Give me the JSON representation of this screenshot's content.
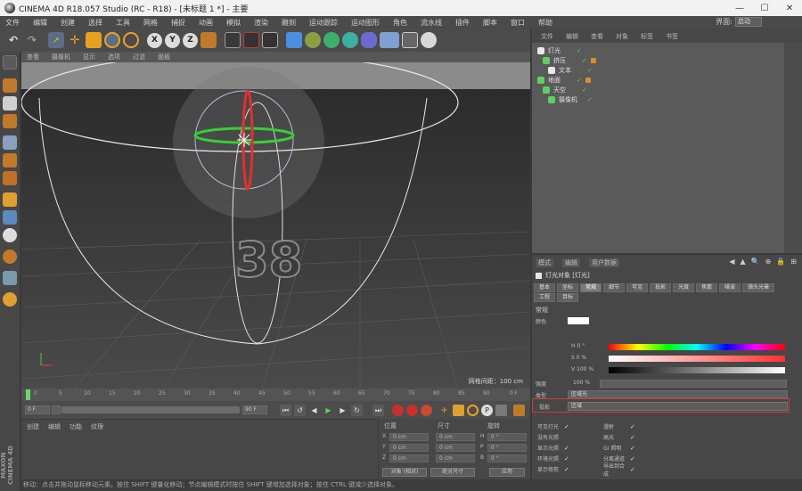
{
  "window": {
    "title": "CINEMA 4D R18.057 Studio (RC - R18) - [未标题 1 *] - 主要",
    "minimize": "—",
    "maximize": "☐",
    "close": "✕"
  },
  "menubar": {
    "items": [
      "文件",
      "编辑",
      "创建",
      "选择",
      "工具",
      "网格",
      "捕捉",
      "动画",
      "模拟",
      "渲染",
      "雕刻",
      "运动跟踪",
      "运动图形",
      "角色",
      "流水线",
      "插件",
      "脚本",
      "窗口",
      "帮助"
    ],
    "layout_label": "界面:",
    "layout_value": "启动"
  },
  "toolbar": {
    "x_label": "X",
    "y_label": "Y",
    "z_label": "Z"
  },
  "viewport": {
    "menu": [
      "查看",
      "摄像机",
      "显示",
      "选项",
      "过滤",
      "面板"
    ],
    "label": "网格间距：100 cm",
    "text_3d": "38"
  },
  "timeline": {
    "ticks": [
      "0",
      "5",
      "10",
      "15",
      "20",
      "25",
      "30",
      "35",
      "40",
      "45",
      "50",
      "55",
      "60",
      "65",
      "70",
      "75",
      "80",
      "85",
      "90",
      "0 F"
    ],
    "start_frame": "0 F",
    "current_frame": "0 F",
    "end_frame": "90 F"
  },
  "material_manager": {
    "menu": [
      "创建",
      "编辑",
      "功能",
      "纹理"
    ]
  },
  "coordinates": {
    "headers": [
      "位置",
      "尺寸",
      "旋转"
    ],
    "rows": [
      {
        "axis": "X",
        "pos": "0 cm",
        "size": "0 cm",
        "rot_axis": "H",
        "rot": "0 °"
      },
      {
        "axis": "Y",
        "pos": "0 cm",
        "size": "0 cm",
        "rot_axis": "P",
        "rot": "0 °"
      },
      {
        "axis": "Z",
        "pos": "0 cm",
        "size": "0 cm",
        "rot_axis": "B",
        "rot": "0 °"
      }
    ],
    "mode": "对象 (相对)",
    "size_mode": "绝对尺寸",
    "apply": "应用"
  },
  "object_manager": {
    "menu": [
      "文件",
      "编辑",
      "查看",
      "对象",
      "标签",
      "书签"
    ],
    "objects": [
      {
        "name": "灯光",
        "color": "#e8e8e8"
      },
      {
        "name": "挤压",
        "color": "#5fd05f"
      },
      {
        "name": "文本",
        "color": "#e8e8e8"
      },
      {
        "name": "地面",
        "color": "#5fd05f"
      },
      {
        "name": "天空",
        "color": "#5fd05f"
      },
      {
        "name": "摄像机",
        "color": "#5fd05f"
      }
    ],
    "check": "✓"
  },
  "attribute_manager": {
    "menu": [
      "模式",
      "编辑",
      "用户数据"
    ],
    "nav_icons": [
      "◀",
      "▲",
      "🔍",
      "⊕",
      "🔒",
      "⊞"
    ],
    "object_name": "灯光对象 [灯光]",
    "tabs_row1": [
      "基本",
      "坐标",
      "常规",
      "细节",
      "可见",
      "投影",
      "光度",
      "焦散",
      "噪波",
      "镜头光晕"
    ],
    "tabs_row2": [
      "工程",
      "目标"
    ],
    "active_tab": "常规",
    "section": "常规",
    "color_label": "颜色",
    "h_label": "H 0 °",
    "s_label": "S 0 %",
    "v_label": "V 100 %",
    "intensity_label": "强度",
    "intensity_value": "100 %",
    "type_label": "类型",
    "type_value": "区域光",
    "shadow_label": "投影",
    "shadow_value": "区域",
    "checkboxes_left": [
      "可见灯光",
      "没有光照",
      "显示光照",
      "环境光照",
      "显示修剪"
    ],
    "checkboxes_right": [
      "漫射",
      "高光",
      "GI 照明",
      "分离通道",
      "导出到合成"
    ],
    "check": "✓"
  },
  "status": {
    "text": "移动：点击并拖动鼠标移动元素。按住 SHIFT 键量化移动；节点编辑模式时按住 SHIFT 键增加选择对象；按住 CTRL 键减少选择对象。"
  },
  "brand": {
    "maxon": "MAXON CINEMA 4D"
  }
}
